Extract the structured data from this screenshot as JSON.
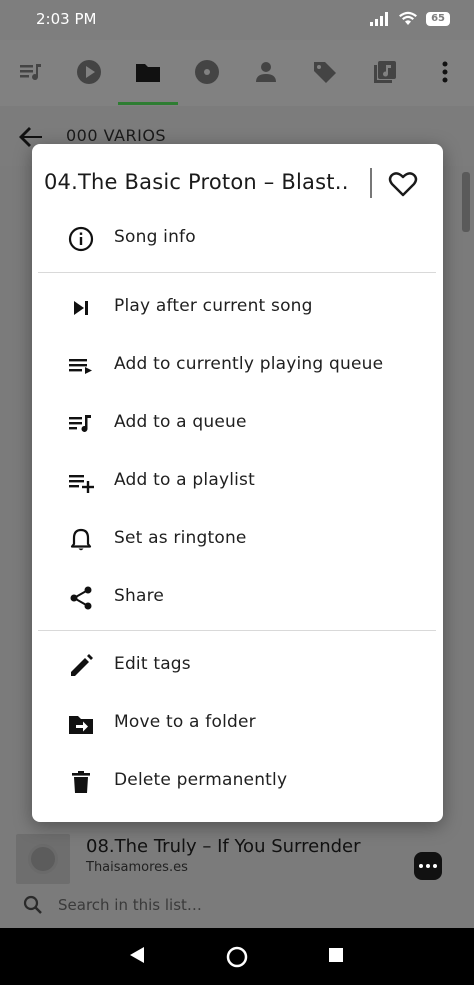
{
  "status": {
    "time": "2:03 PM",
    "battery": "65"
  },
  "appbar": {
    "title": "000 VARIOS"
  },
  "dialog": {
    "title": "04.The Basic Proton – Blast‥",
    "groups": [
      [
        {
          "label": "Song info",
          "icon": "info-icon"
        }
      ],
      [
        {
          "label": "Play after current song",
          "icon": "play-next-icon"
        },
        {
          "label": "Add to currently playing queue",
          "icon": "add-queue-icon"
        },
        {
          "label": "Add to a queue",
          "icon": "queue-music-icon"
        },
        {
          "label": "Add to a playlist",
          "icon": "playlist-add-icon"
        },
        {
          "label": "Set as ringtone",
          "icon": "bell-icon"
        },
        {
          "label": "Share",
          "icon": "share-icon"
        }
      ],
      [
        {
          "label": "Edit tags",
          "icon": "pencil-icon"
        },
        {
          "label": "Move to a folder",
          "icon": "move-folder-icon"
        },
        {
          "label": "Delete permanently",
          "icon": "trash-icon"
        }
      ]
    ]
  },
  "mini_player": {
    "song": "08.The Truly – If You Surrender",
    "artist": "Thaisamores.es"
  },
  "search": {
    "placeholder": "Search in this list…"
  }
}
